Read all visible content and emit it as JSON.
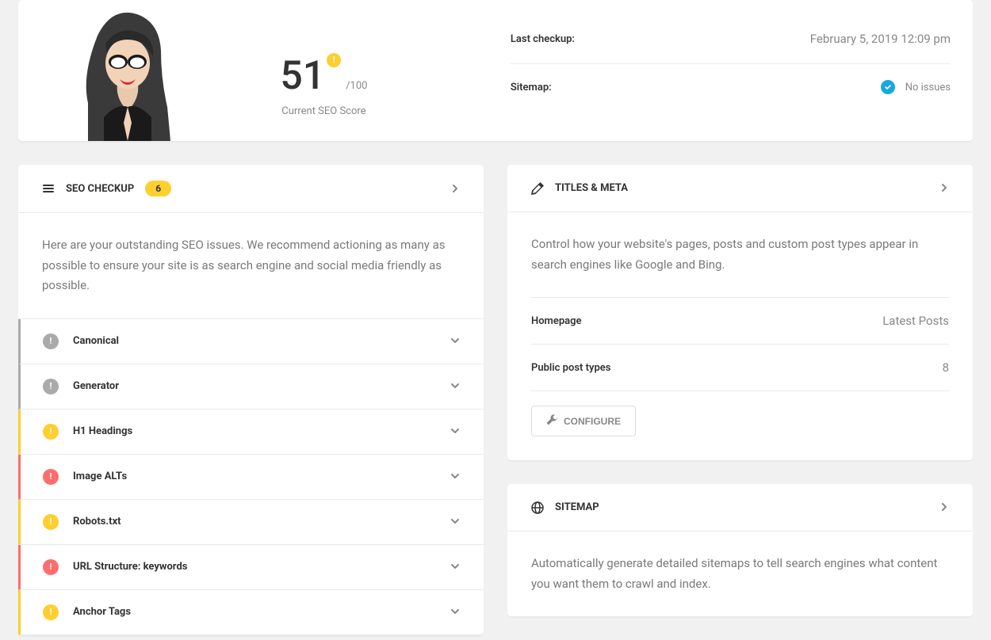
{
  "colors": {
    "yellow": "#FECF2F",
    "red": "#FF6D6D",
    "gray": "#AAAAAA",
    "blue": "#17A8E3"
  },
  "top": {
    "score": "51",
    "score_max": "/100",
    "score_label": "Current SEO Score",
    "last_checkup_label": "Last checkup:",
    "last_checkup_value": "February 5, 2019 12:09 pm",
    "sitemap_label": "Sitemap:",
    "sitemap_status": "No issues"
  },
  "seo_checkup": {
    "title": "SEO CHECKUP",
    "badge": "6",
    "desc": "Here are your outstanding SEO issues. We recommend actioning as many as possible to ensure your site is as search engine and social media friendly as possible.",
    "issues": [
      {
        "label": "Canonical",
        "level": "gray"
      },
      {
        "label": "Generator",
        "level": "gray"
      },
      {
        "label": "H1 Headings",
        "level": "yellow"
      },
      {
        "label": "Image ALTs",
        "level": "red"
      },
      {
        "label": "Robots.txt",
        "level": "yellow"
      },
      {
        "label": "URL Structure: keywords",
        "level": "red"
      },
      {
        "label": "Anchor Tags",
        "level": "yellow"
      }
    ]
  },
  "titles_meta": {
    "title": "TITLES & META",
    "desc": "Control how your website's pages, posts and custom post types appear in search engines like Google and Bing.",
    "homepage_label": "Homepage",
    "homepage_value": "Latest Posts",
    "post_types_label": "Public post types",
    "post_types_value": "8",
    "configure_label": "CONFIGURE"
  },
  "sitemap": {
    "title": "SITEMAP",
    "desc": "Automatically generate detailed sitemaps to tell search engines what content you want them to crawl and index."
  }
}
